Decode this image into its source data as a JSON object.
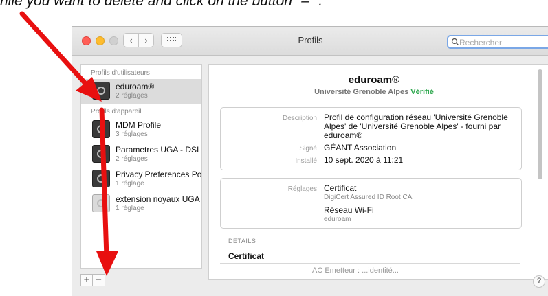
{
  "caption": "hile you want to delete and click on the button \"–\" .",
  "window": {
    "title": "Profils",
    "search_placeholder": "Rechercher"
  },
  "sidebar": {
    "user_group": "Profils d'utilisateurs",
    "device_group": "Profils d'appareil",
    "user_profiles": [
      {
        "name": "eduroam®",
        "detail": "2 réglages"
      }
    ],
    "device_profiles": [
      {
        "name": "MDM Profile",
        "detail": "3 réglages"
      },
      {
        "name": "Parametres UGA - DSI",
        "detail": "2 réglages"
      },
      {
        "name": "Privacy Preferences Poli",
        "detail": "1 réglage"
      },
      {
        "name": "extension noyaux UGA",
        "detail": "1 réglage"
      }
    ],
    "add_label": "+",
    "remove_label": "−"
  },
  "detail": {
    "title": "eduroam®",
    "org": "Université Grenoble Alpes",
    "verified": "Vérifié",
    "desc_label": "Description",
    "desc_value": "Profil de configuration réseau 'Université Grenoble Alpes' de 'Université Grenoble Alpes' - fourni par eduroam®",
    "signed_label": "Signé",
    "signed_value": "GÉANT Association",
    "installed_label": "Installé",
    "installed_value": "10 sept. 2020 à 11:21",
    "settings_label": "Réglages",
    "settings": [
      {
        "name": "Certificat",
        "sub": "DigiCert Assured ID Root CA"
      },
      {
        "name": "Réseau Wi-Fi",
        "sub": "eduroam"
      }
    ],
    "details_heading": "DÉTAILS",
    "cert_heading": "Certificat",
    "cert_partial": "AC Emetteur : ...identité..."
  },
  "help_label": "?",
  "colors": {
    "verified": "#2fa84f",
    "arrow": "#e81010",
    "close": "#ff5f57",
    "minimize": "#febc2e"
  }
}
